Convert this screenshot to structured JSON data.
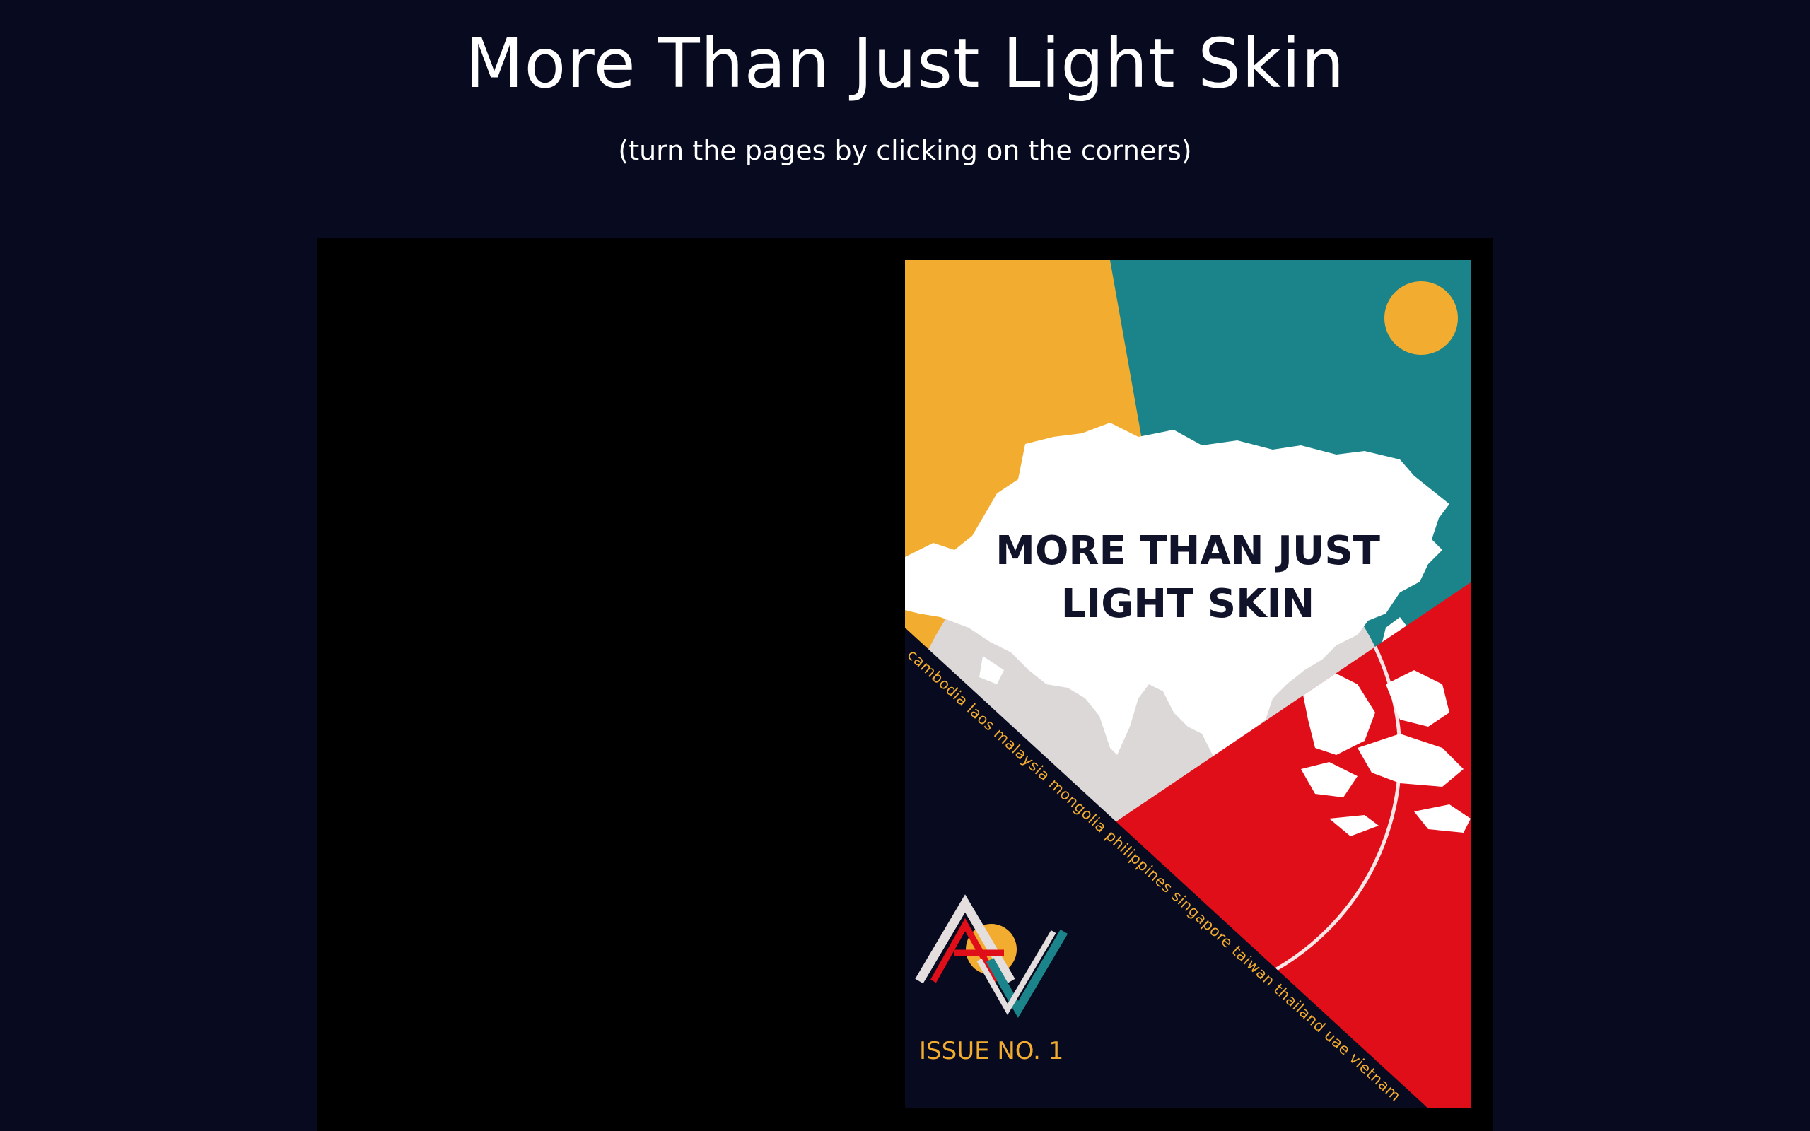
{
  "page": {
    "title": "More Than Just Light Skin",
    "subtitle": "(turn the pages by clicking on the corners)"
  },
  "cover": {
    "title_line1": "MORE THAN JUST",
    "title_line2": "LIGHT SKIN",
    "countries": "cambodia laos malaysia mongolia philippines singapore taiwan thailand uae vietnam",
    "issue": "ISSUE NO. 1",
    "logo_icon": "av-logo-icon",
    "map_icon": "asia-map-icon",
    "sun_icon": "sun-circle-icon"
  },
  "colors": {
    "background": "#080b1f",
    "book": "#000000",
    "yellow": "#f2ac30",
    "teal": "#1b848a",
    "red": "#e00e19",
    "navy": "#080b1f",
    "globe": "#ddd8d8",
    "land": "#ffffff"
  }
}
